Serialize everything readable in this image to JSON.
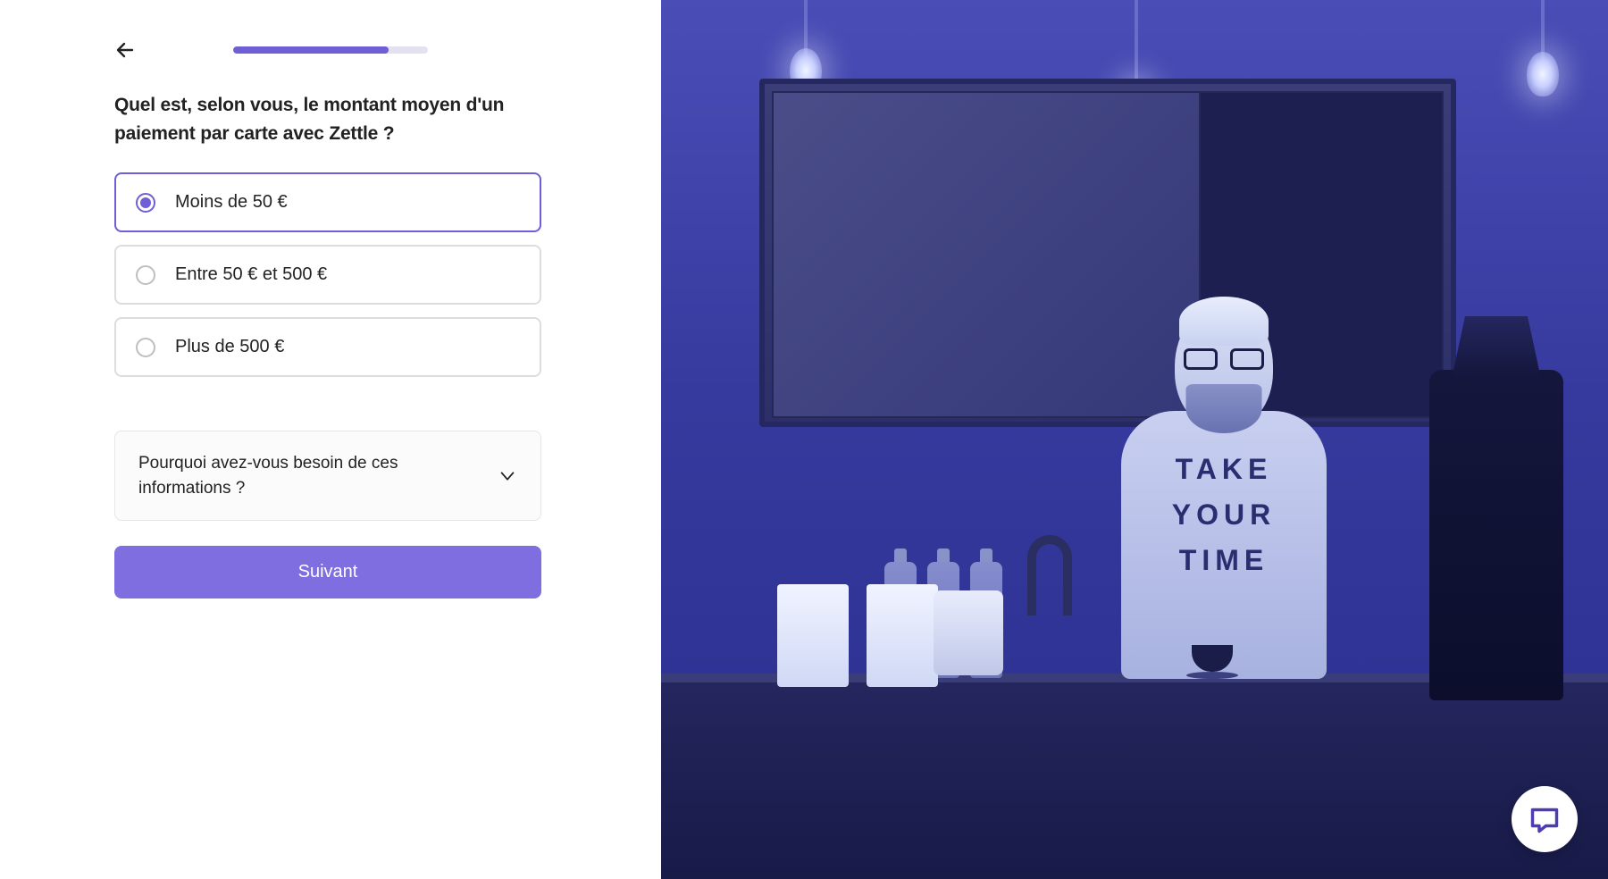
{
  "progress": {
    "percent": 80
  },
  "question": "Quel est, selon vous, le montant moyen d'un paiement par carte avec Zettle ?",
  "options": [
    {
      "label": "Moins de 50 €",
      "selected": true
    },
    {
      "label": "Entre 50 € et 500 €",
      "selected": false
    },
    {
      "label": "Plus de 500 €",
      "selected": false
    }
  ],
  "info_accordion": "Pourquoi avez-vous besoin de ces informations ?",
  "next_button": "Suivant",
  "illustration": {
    "shirt_line1": "TAKE",
    "shirt_line2": "YOUR",
    "shirt_line3": "TIME"
  },
  "colors": {
    "primary": "#6f5fd6",
    "button": "#7f6ee0"
  }
}
